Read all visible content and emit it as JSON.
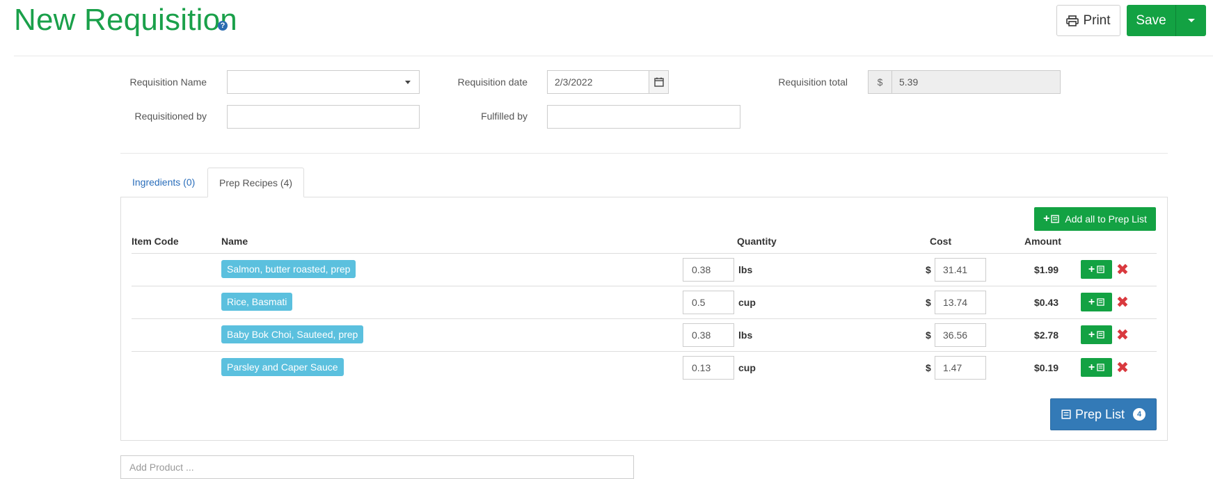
{
  "header": {
    "title": "New Requisition",
    "help_icon": "?",
    "print_label": "Print",
    "save_label": "Save"
  },
  "form": {
    "requisition_name_label": "Requisition Name",
    "requisition_name_value": "",
    "requisition_date_label": "Requisition date",
    "requisition_date_value": "2/3/2022",
    "requisition_total_label": "Requisition total",
    "currency_symbol": "$",
    "requisition_total_value": "5.39",
    "requisitioned_by_label": "Requisitioned by",
    "requisitioned_by_value": "",
    "fulfilled_by_label": "Fulfilled by",
    "fulfilled_by_value": ""
  },
  "tabs": [
    {
      "label": "Ingredients (0)",
      "active": false
    },
    {
      "label": "Prep Recipes (4)",
      "active": true
    }
  ],
  "table": {
    "add_all_label": "Add all to Prep List",
    "headers": {
      "item_code": "Item Code",
      "name": "Name",
      "quantity": "Quantity",
      "cost": "Cost",
      "amount": "Amount"
    },
    "rows": [
      {
        "item_code": "",
        "name": "Salmon, butter roasted, prep",
        "quantity": "0.38",
        "unit": "lbs",
        "currency": "$",
        "cost": "31.41",
        "amount": "$1.99"
      },
      {
        "item_code": "",
        "name": "Rice, Basmati",
        "quantity": "0.5",
        "unit": "cup",
        "currency": "$",
        "cost": "13.74",
        "amount": "$0.43"
      },
      {
        "item_code": "",
        "name": "Baby Bok Choi, Sauteed, prep",
        "quantity": "0.38",
        "unit": "lbs",
        "currency": "$",
        "cost": "36.56",
        "amount": "$2.78"
      },
      {
        "item_code": "",
        "name": "Parsley and Caper Sauce",
        "quantity": "0.13",
        "unit": "cup",
        "currency": "$",
        "cost": "1.47",
        "amount": "$0.19"
      }
    ],
    "delete_symbol": "✖",
    "prep_list_label": "Prep List",
    "prep_list_count": "4"
  },
  "add_product": {
    "placeholder": "Add Product ..."
  },
  "colors": {
    "brand_green": "#13a243",
    "title_green": "#1aa04a",
    "tag_blue": "#5bc0de",
    "primary_blue": "#337ab7",
    "danger_red": "#d9393e"
  }
}
